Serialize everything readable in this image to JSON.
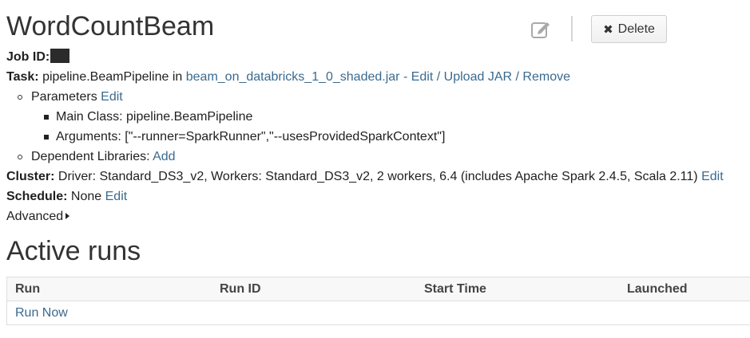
{
  "job": {
    "title": "WordCountBeam",
    "delete_label": "Delete",
    "job_id_label": "Job ID:",
    "task_label": "Task:",
    "task_class": "pipeline.BeamPipeline",
    "task_in": "in",
    "task_jar": "beam_on_databricks_1_0_shaded.jar",
    "task_sep1": "-",
    "task_edit": "Edit",
    "task_slash1": "/",
    "task_upload": "Upload JAR",
    "task_slash2": "/",
    "task_remove": "Remove",
    "parameters_label": "Parameters",
    "parameters_edit": "Edit",
    "main_class_label": "Main Class:",
    "main_class_value": "pipeline.BeamPipeline",
    "arguments_label": "Arguments:",
    "arguments_value": "[\"--runner=SparkRunner\",\"--usesProvidedSparkContext\"]",
    "dependent_label": "Dependent Libraries:",
    "dependent_add": "Add",
    "cluster_label": "Cluster:",
    "cluster_value": "Driver: Standard_DS3_v2, Workers: Standard_DS3_v2, 2 workers, 6.4 (includes Apache Spark 2.4.5, Scala 2.11)",
    "cluster_edit": "Edit",
    "schedule_label": "Schedule:",
    "schedule_value": "None",
    "schedule_edit": "Edit",
    "advanced_label": "Advanced"
  },
  "active_runs": {
    "title": "Active runs",
    "columns": [
      "Run",
      "Run ID",
      "Start Time",
      "Launched"
    ],
    "run_now": "Run Now"
  },
  "icons": {
    "edit": "pencil-square-icon",
    "delete": "x-icon",
    "advanced": "caret-right-icon"
  },
  "colors": {
    "link": "#3a6a8f",
    "title": "#333333",
    "border": "#dedede"
  }
}
